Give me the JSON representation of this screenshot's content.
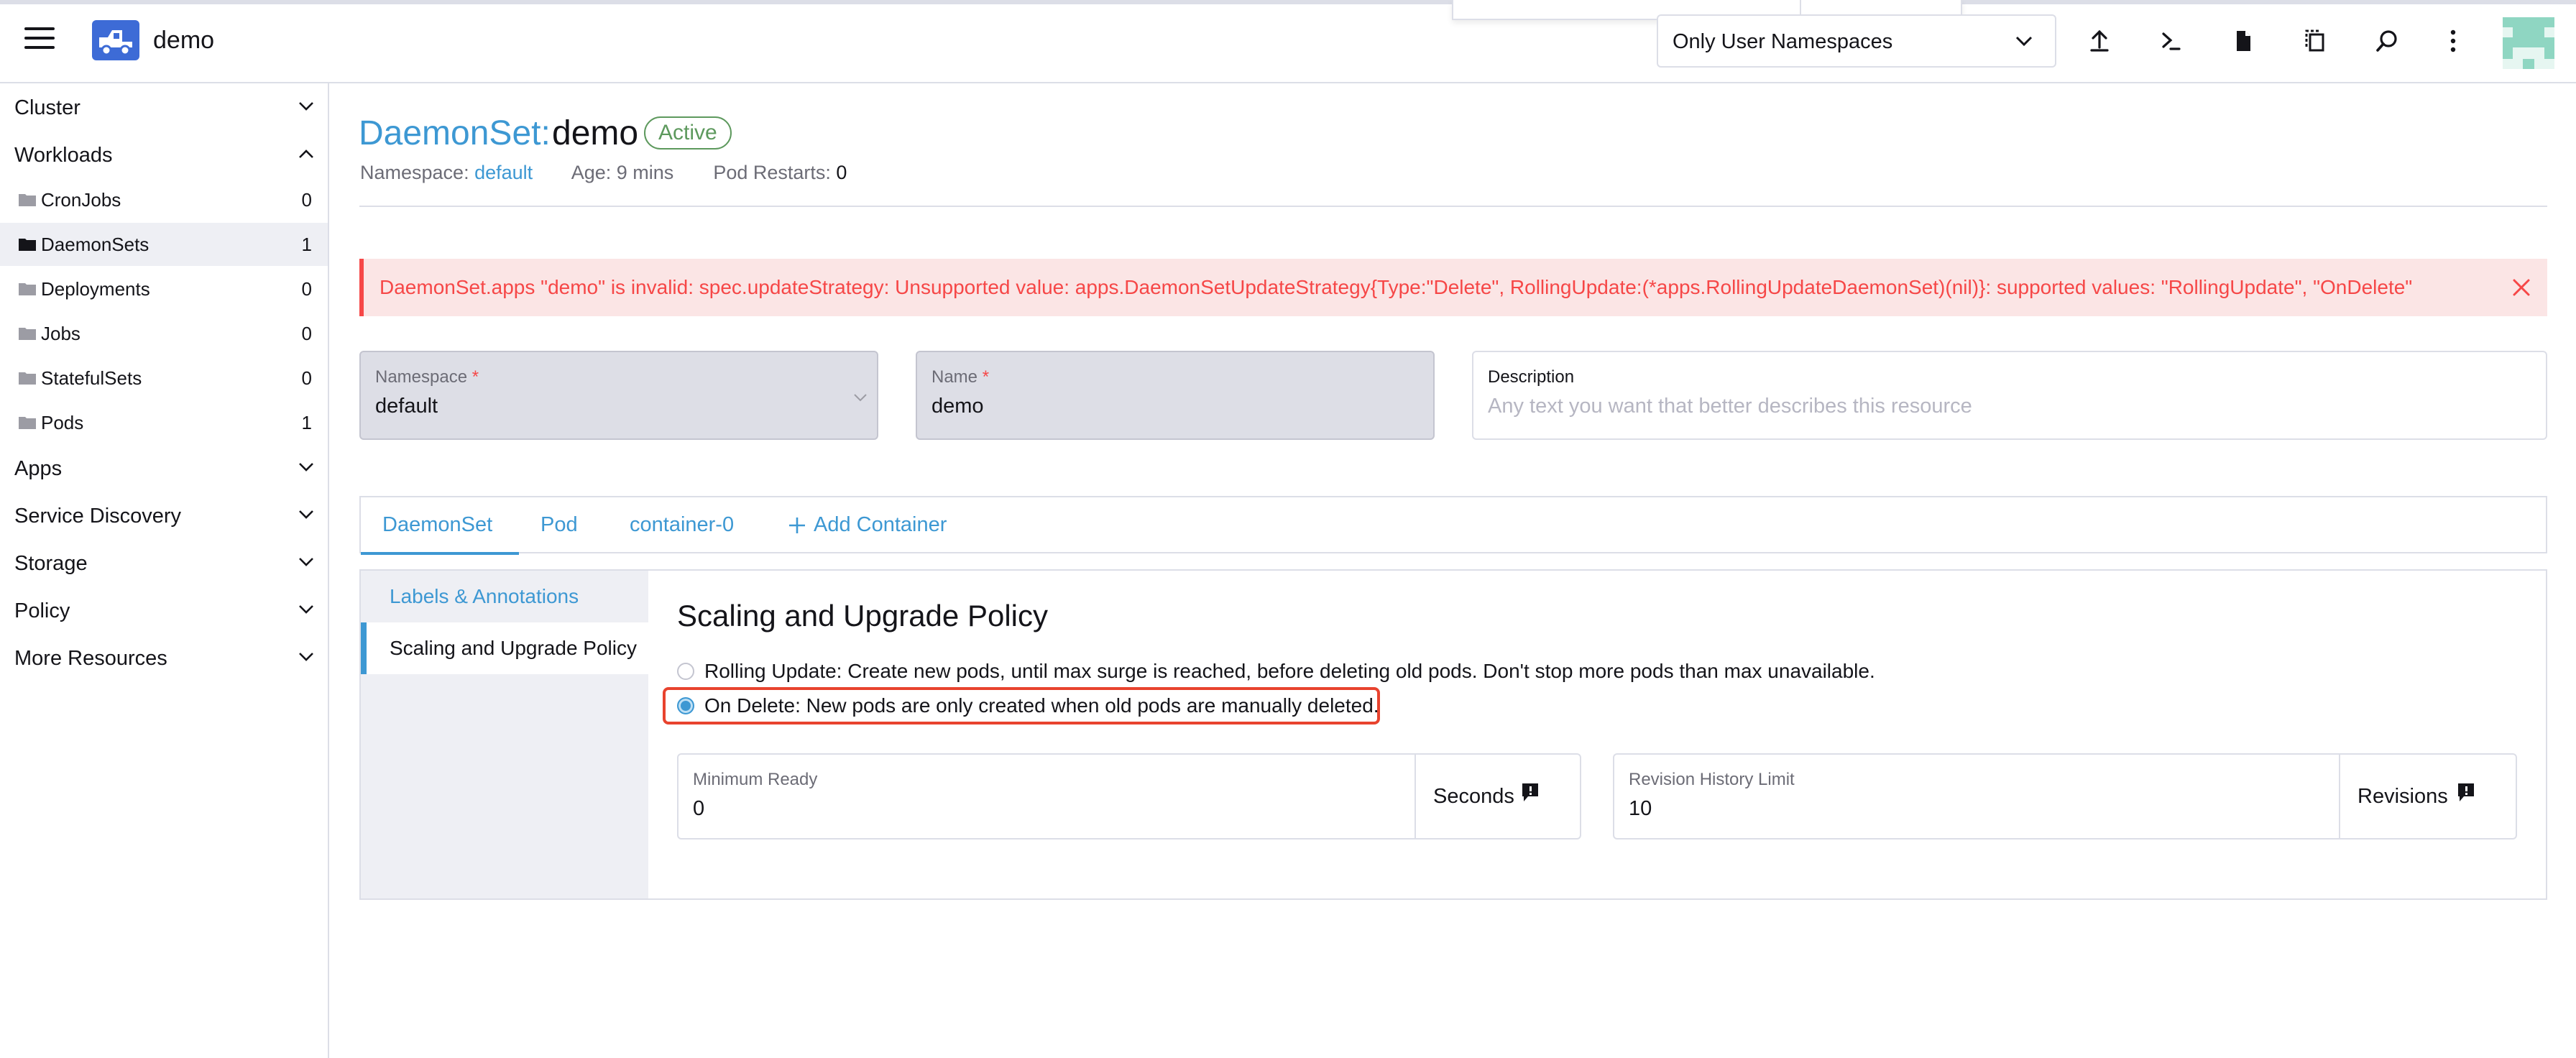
{
  "header": {
    "cluster_name": "demo",
    "namespace_filter": "Only User Namespaces",
    "actions": [
      "import-yaml",
      "kubectl-shell",
      "kubeconfig-download",
      "copy-kubeconfig",
      "search",
      "more"
    ]
  },
  "sidebar": {
    "groups": {
      "cluster": "Cluster",
      "workloads": "Workloads",
      "apps": "Apps",
      "service_discovery": "Service Discovery",
      "storage": "Storage",
      "policy": "Policy",
      "more_resources": "More Resources"
    },
    "workloads": [
      {
        "label": "CronJobs",
        "count": "0"
      },
      {
        "label": "DaemonSets",
        "count": "1"
      },
      {
        "label": "Deployments",
        "count": "0"
      },
      {
        "label": "Jobs",
        "count": "0"
      },
      {
        "label": "StatefulSets",
        "count": "0"
      },
      {
        "label": "Pods",
        "count": "1"
      }
    ]
  },
  "page": {
    "kind": "DaemonSet:",
    "name": "demo",
    "status": "Active",
    "meta": {
      "namespace_label": "Namespace:",
      "namespace_value": "default",
      "age_label": "Age:",
      "age_value": "9 mins",
      "restarts_label": "Pod Restarts:",
      "restarts_value": "0"
    }
  },
  "error": {
    "message": "DaemonSet.apps \"demo\" is invalid: spec.updateStrategy: Unsupported value: apps.DaemonSetUpdateStrategy{Type:\"Delete\", RollingUpdate:(*apps.RollingUpdateDaemonSet)(nil)}: supported values: \"RollingUpdate\", \"OnDelete\""
  },
  "form": {
    "namespace": {
      "label": "Namespace",
      "required": "*",
      "value": "default"
    },
    "name": {
      "label": "Name",
      "required": "*",
      "value": "demo"
    },
    "description": {
      "label": "Description",
      "placeholder": "Any text you want that better describes this resource"
    }
  },
  "tabs": {
    "daemonset": "DaemonSet",
    "pod": "Pod",
    "container": "container-0",
    "add_container": "Add Container"
  },
  "side_tabs": {
    "labels": "Labels & Annotations",
    "scaling": "Scaling and Upgrade Policy"
  },
  "scaling": {
    "title": "Scaling and Upgrade Policy",
    "rolling_update": "Rolling Update: Create new pods, until max surge is reached, before deleting old pods. Don't stop more pods than max unavailable.",
    "on_delete": "On Delete: New pods are only created when old pods are manually deleted.",
    "min_ready": {
      "label": "Minimum Ready",
      "value": "0",
      "suffix": "Seconds"
    },
    "revision_history": {
      "label": "Revision History Limit",
      "value": "10",
      "suffix": "Revisions"
    }
  },
  "colors": {
    "accent": "#3d98d3",
    "error": "#f64747",
    "success": "#5d995d",
    "highlight": "#e8432e"
  }
}
